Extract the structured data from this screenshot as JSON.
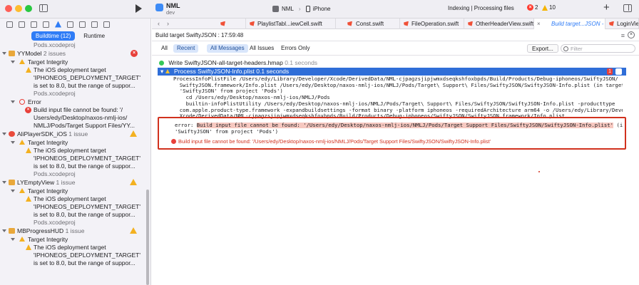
{
  "titlebar": {
    "project_name": "NML",
    "project_branch": "dev",
    "scheme": "NML",
    "destination": "iPhone",
    "status": "Indexing | Processing files",
    "error_count": "2",
    "warning_count": "10"
  },
  "navigator": {
    "tabs": [
      {
        "label": "Buildtime (12)",
        "selected": true
      },
      {
        "label": "Runtime",
        "selected": false
      }
    ],
    "items": [
      {
        "kind": "sub",
        "text": "Pods.xcodeproj"
      },
      {
        "kind": "project",
        "name": "YYModel",
        "count": "2 issues",
        "status": "error"
      },
      {
        "kind": "category",
        "name": "Target Integrity",
        "status": "warning"
      },
      {
        "kind": "message",
        "status": "warning",
        "lines": [
          "The iOS deployment target",
          "'IPHONEOS_DEPLOYMENT_TARGET'",
          "is set to 8.0, but the range of suppor..."
        ],
        "sub": "Pods.xcodeproj"
      },
      {
        "kind": "category",
        "name": "Error",
        "status": "error"
      },
      {
        "kind": "message",
        "status": "error",
        "lines": [
          "Build input file cannot be found: '/",
          "Users/edy/Desktop/naxos-nmlj-ios/",
          "NMLJ/Pods/Target Support Files/YY..."
        ],
        "sub": ""
      },
      {
        "kind": "project",
        "name": "AliPlayerSDK_iOS",
        "count": "1 issue",
        "status": "warning"
      },
      {
        "kind": "category",
        "name": "Target Integrity",
        "status": "warning"
      },
      {
        "kind": "message",
        "status": "warning",
        "lines": [
          "The iOS deployment target",
          "'IPHONEOS_DEPLOYMENT_TARGET'",
          "is set to 8.0, but the range of suppor..."
        ],
        "sub": "Pods.xcodeproj"
      },
      {
        "kind": "project",
        "name": "LYEmptyView",
        "count": "1 issue",
        "status": "warning"
      },
      {
        "kind": "category",
        "name": "Target Integrity",
        "status": "warning"
      },
      {
        "kind": "message",
        "status": "warning",
        "lines": [
          "The iOS deployment target",
          "'IPHONEOS_DEPLOYMENT_TARGET'",
          "is set to 8.0, but the range of suppor..."
        ],
        "sub": "Pods.xcodeproj"
      },
      {
        "kind": "project",
        "name": "MBProgressHUD",
        "count": "1 issue",
        "status": "warning"
      },
      {
        "kind": "category",
        "name": "Target Integrity",
        "status": "warning"
      },
      {
        "kind": "message",
        "status": "warning",
        "lines": [
          "The iOS deployment target",
          "'IPHONEOS_DEPLOYMENT_TARGET'",
          "is set to 8.0, but the range of suppor..."
        ],
        "sub": ""
      }
    ]
  },
  "editor_tabs": [
    {
      "label": "PlaylistTabl...iewCell.swift",
      "active": false
    },
    {
      "label": "Const.swift",
      "active": false
    },
    {
      "label": "FileOperation.swift",
      "active": false
    },
    {
      "label": "OtherHeaderView.swift",
      "active": false
    },
    {
      "label": "Build target...JSON - Log",
      "active": true
    },
    {
      "label": "LoginView",
      "active": false
    }
  ],
  "breadcrumb": "Build target SwiftyJSON : 17:59:48",
  "filterbar": {
    "buttons": [
      {
        "label": "All",
        "selected": false
      },
      {
        "label": "Recent",
        "selected": true
      },
      {
        "label": "All Messages",
        "selected": true
      },
      {
        "label": "All Issues",
        "selected": false
      },
      {
        "label": "Errors Only",
        "selected": false
      }
    ],
    "export_label": "Export...",
    "filter_placeholder": "Filter"
  },
  "log": {
    "step1_label": "Write SwiftyJSON-all-target-headers.hmap",
    "step1_time": "0.1 seconds",
    "step2_label": "Process SwiftyJSON-Info.plist",
    "step2_time": "0.1 seconds",
    "step2_badge": "1",
    "command": "ProcessInfoPlistFile /Users/edy/Library/Developer/Xcode/DerivedData/NML-cjpagzsjipjwmxdseqkshfoxbpds/Build/Products/Debug-iphoneos/SwiftyJSON/\n  SwiftyJSON.framework/Info.plist /Users/edy/Desktop/naxos-nmlj-ios/NMLJ/Pods/Target\\ Support\\ Files/SwiftyJSON/SwiftyJSON-Info.plist (in target\n  'SwiftyJSON' from project 'Pods')\n    cd /Users/edy/Desktop/naxos-nmlj-ios/NMLJ/Pods\n    builtin-infoPlistUtility /Users/edy/Desktop/naxos-nmlj-ios/NMLJ/Pods/Target\\ Support\\ Files/SwiftyJSON/SwiftyJSON-Info.plist -producttype\n  com.apple.product-type.framework -expandbuildsettings -format binary -platform iphoneos -requiredArchitecture arm64 -o /Users/edy/Library/Developer/\n  Xcode/DerivedData/NML-cjpagzsjipjwmxdseqkshfoxbpds/Build/Products/Debug-iphoneos/SwiftyJSON/SwiftyJSON.framework/Info.plist",
    "error_prefix": "error: ",
    "error_highlight": "Build input file cannot be found: '/Users/edy/Desktop/naxos-nmlj-ios/NMLJ/Pods/Target Support Files/SwiftyJSON/SwiftyJSON-Info.plist'",
    "error_suffix": " (in target",
    "error_line2": "'SwiftyJSON' from project 'Pods')",
    "error_summary": "Build input file cannot be found: '/Users/edy/Desktop/naxos-nmlj-ios/NMLJ/Pods/Target Support Files/SwiftyJSON/SwiftyJSON-Info.plist'"
  }
}
